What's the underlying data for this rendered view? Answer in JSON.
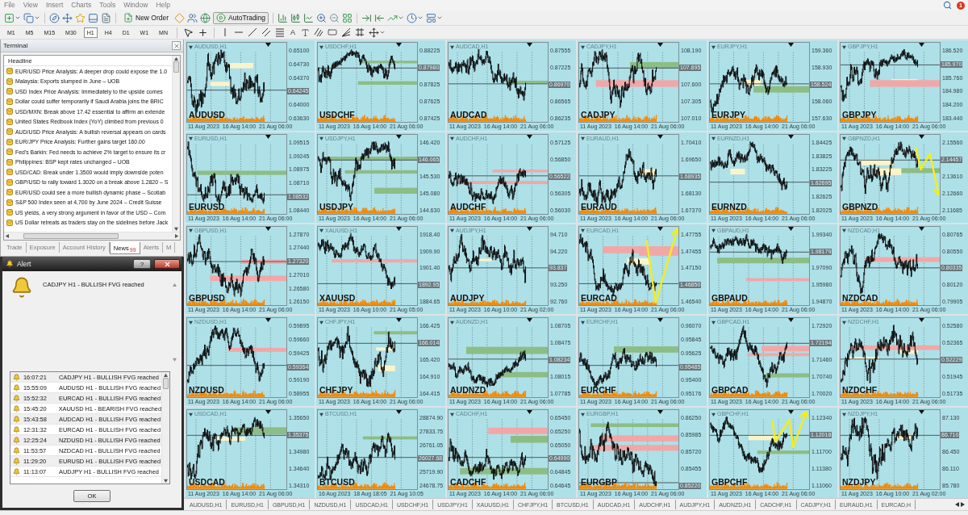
{
  "menu": [
    "File",
    "View",
    "Insert",
    "Charts",
    "Tools",
    "Window",
    "Help"
  ],
  "notification_count": "1",
  "toolbar": {
    "new_order": "New Order",
    "autotrading": "AutoTrading"
  },
  "timeframes": [
    {
      "label": "M1",
      "selected": false
    },
    {
      "label": "M5",
      "selected": false
    },
    {
      "label": "M15",
      "selected": false
    },
    {
      "label": "M30",
      "selected": false
    },
    {
      "label": "H1",
      "selected": true
    },
    {
      "label": "H4",
      "selected": false
    },
    {
      "label": "D1",
      "selected": false
    },
    {
      "label": "W1",
      "selected": false
    },
    {
      "label": "MN",
      "selected": false
    }
  ],
  "text_tool": "A",
  "terminal": {
    "title": "Terminal",
    "column": "Headline",
    "news": [
      "EUR/USD Price Analysis: A deeper drop could expose the 1.0",
      "Malaysia: Exports slumped in June – UOB",
      "USD Index Price Analysis: Immediately to the upside comes",
      "Dollar could suffer temporarily if Saudi Arabia joins the BRIC",
      "USD/MXN: Break above 17.42 essential to affirm an extende",
      "United States Redbook Index (YoY) climbed from previous 0",
      "AUD/USD Price Analysis: A bullish reversal appears on cards",
      "EUR/JPY Price Analysis: Further gains target 160.00",
      "Fed's Barkin: Fed needs to achieve 2% target to ensure its cr",
      "Philippines: BSP kept rates unchanged – UOB",
      "USD/CAD: Break under 1.3500 would imply downside poten",
      "GBP/USD to rally toward 1.3020 on a break above 1.2820 – S",
      "EUR/USD could see a more bullish dynamic phase – Scotiab",
      "S&P 500 Index seen at 4,700 by June 2024 – Credit Suisse",
      "US yields, a very strong argument in favor of the USD – Com",
      "US Dollar retreats as traders stay on the sidelines before Jack"
    ],
    "tabs": [
      {
        "label": "Trade",
        "selected": false
      },
      {
        "label": "Exposure",
        "selected": false
      },
      {
        "label": "Account History",
        "selected": false
      },
      {
        "label": "News",
        "selected": true,
        "badge": "99"
      },
      {
        "label": "Alerts",
        "selected": false
      },
      {
        "label": "M",
        "selected": false
      }
    ]
  },
  "alert": {
    "title": "Alert",
    "help": "?",
    "message": "CADJPY H1 - BULLISH FVG reached",
    "rows": [
      {
        "time": "16:07:21",
        "text": "CADJPY H1 - BULLISH FVG reached"
      },
      {
        "time": "15:55:09",
        "text": "AUDUSD H1 - BULLISH FVG reached"
      },
      {
        "time": "15:52:32",
        "text": "EURCAD H1 - BULLISH FVG reached"
      },
      {
        "time": "15:45:20",
        "text": "XAUUSD H1 - BEARISH FVG reached"
      },
      {
        "time": "15:43:58",
        "text": "AUDCAD H1 - BULLISH FVG reached"
      },
      {
        "time": "12:31:32",
        "text": "EURCAD H1 - BULLISH FVG reached"
      },
      {
        "time": "12:25:24",
        "text": "NZDUSD H1 - BULLISH FVG reached"
      },
      {
        "time": "11:53:57",
        "text": "NZDCAD H1 - BULLISH FVG reached"
      },
      {
        "time": "11:29:20",
        "text": "EURUSD H1 - BULLISH FVG reached"
      },
      {
        "time": "11:13:07",
        "text": "AUDJPY H1 - BULLISH FVG reached"
      }
    ],
    "button": "OK"
  },
  "charts": [
    {
      "title": "AUDUSD,H1",
      "symbol": "AUDUSD",
      "price_axis": [
        {
          "kind": "tick",
          "text": "0.65100"
        },
        {
          "kind": "tick",
          "text": "0.64730"
        },
        {
          "kind": "tick",
          "text": "0.64370"
        },
        {
          "kind": "current",
          "text": "0.64245"
        },
        {
          "kind": "tick",
          "text": "0.64000"
        },
        {
          "kind": "tick",
          "text": "0.63630"
        }
      ],
      "time_axis": [
        "11 Aug 2023",
        "16 Aug 14:00",
        "21 Aug 06:00"
      ]
    },
    {
      "title": "USDCHF,H1",
      "symbol": "USDCHF",
      "price_axis": [
        {
          "kind": "tick",
          "text": "0.88225"
        },
        {
          "kind": "current",
          "text": "0.87980"
        },
        {
          "kind": "tick",
          "text": "0.87825"
        },
        {
          "kind": "tick",
          "text": "0.87625"
        },
        {
          "kind": "tick",
          "text": "0.87425"
        }
      ],
      "time_axis": [
        "11 Aug 2023",
        "16 Aug 14:00",
        "21 Aug 06:00"
      ]
    },
    {
      "title": "AUDCAD,H1",
      "symbol": "AUDCAD",
      "price_axis": [
        {
          "kind": "tick",
          "text": "0.87555"
        },
        {
          "kind": "tick",
          "text": "0.87225"
        },
        {
          "kind": "current",
          "text": "0.86970"
        },
        {
          "kind": "tick",
          "text": "0.86565"
        },
        {
          "kind": "tick",
          "text": "0.86235"
        }
      ],
      "time_axis": [
        "11 Aug 2023",
        "16 Aug 14:00",
        "21 Aug 06:00"
      ]
    },
    {
      "title": "CADJPY,H1",
      "symbol": "CADJPY",
      "price_axis": [
        {
          "kind": "tick",
          "text": "108.190"
        },
        {
          "kind": "current",
          "text": "107.895"
        },
        {
          "kind": "tick",
          "text": "107.600"
        },
        {
          "kind": "tick",
          "text": "107.305"
        },
        {
          "kind": "tick",
          "text": "107.010"
        }
      ],
      "time_axis": [
        "11 Aug 2023",
        "16 Aug 14:00",
        "21 Aug 06:00"
      ]
    },
    {
      "title": "EURJPY,H1",
      "symbol": "EURJPY",
      "price_axis": [
        {
          "kind": "tick",
          "text": "159.360"
        },
        {
          "kind": "tick",
          "text": "158.930"
        },
        {
          "kind": "current",
          "text": "158.524"
        },
        {
          "kind": "tick",
          "text": "158.060"
        },
        {
          "kind": "tick",
          "text": "157.630"
        }
      ],
      "time_axis": [
        "11 Aug 2023",
        "16 Aug 14:00",
        "21 Aug 06:00"
      ]
    },
    {
      "title": "GBPJPY,H1",
      "symbol": "GBPJPY",
      "price_axis": [
        {
          "kind": "tick",
          "text": "186.520"
        },
        {
          "kind": "current",
          "text": "185.970"
        },
        {
          "kind": "tick",
          "text": "185.760"
        },
        {
          "kind": "tick",
          "text": "184.980"
        },
        {
          "kind": "tick",
          "text": "184.200"
        },
        {
          "kind": "tick",
          "text": "183.440"
        }
      ],
      "time_axis": [
        "11 Aug 2023",
        "16 Aug 14:00",
        "21 Aug 06:00"
      ]
    },
    {
      "title": "EURUSD,H1",
      "symbol": "EURUSD",
      "price_axis": [
        {
          "kind": "tick",
          "text": "1.09515"
        },
        {
          "kind": "tick",
          "text": "1.09245"
        },
        {
          "kind": "tick",
          "text": "1.08975"
        },
        {
          "kind": "tick",
          "text": "1.08710"
        },
        {
          "kind": "current",
          "text": "1.08532"
        },
        {
          "kind": "tick",
          "text": "1.08440"
        }
      ],
      "time_axis": [
        "11 Aug 2023",
        "16 Aug 14:00",
        "21 Aug 06:00"
      ]
    },
    {
      "title": "USDJPY,H1",
      "symbol": "USDJPY",
      "price_axis": [
        {
          "kind": "tick",
          "text": "146.420"
        },
        {
          "kind": "current",
          "text": "146.065"
        },
        {
          "kind": "tick",
          "text": "145.530"
        },
        {
          "kind": "tick",
          "text": "145.080"
        },
        {
          "kind": "tick",
          "text": "144.630"
        }
      ],
      "time_axis": [
        "11 Aug 2023",
        "16 Aug 14:00",
        "21 Aug 06:00"
      ]
    },
    {
      "title": "AUDCHF,H1",
      "symbol": "AUDCHF",
      "price_axis": [
        {
          "kind": "tick",
          "text": "0.57125"
        },
        {
          "kind": "tick",
          "text": "0.56850"
        },
        {
          "kind": "current",
          "text": "0.56522"
        },
        {
          "kind": "tick",
          "text": "0.56305"
        },
        {
          "kind": "tick",
          "text": "0.56030"
        }
      ],
      "time_axis": [
        "11 Aug 2023",
        "16 Aug 14:00",
        "21 Aug 06:00"
      ]
    },
    {
      "title": "EURAUD,H1",
      "symbol": "EURAUD",
      "price_axis": [
        {
          "kind": "tick",
          "text": "1.70410"
        },
        {
          "kind": "tick",
          "text": "1.69650"
        },
        {
          "kind": "current",
          "text": "1.68935"
        },
        {
          "kind": "tick",
          "text": "1.68130"
        },
        {
          "kind": "tick",
          "text": "1.67370"
        }
      ],
      "time_axis": [
        "11 Aug 2023",
        "16 Aug 14:00",
        "21 Aug 06:00"
      ]
    },
    {
      "title": "EURNZD,H1",
      "symbol": "EURNZD",
      "price_axis": [
        {
          "kind": "tick",
          "text": "1.84425"
        },
        {
          "kind": "tick",
          "text": "1.83825"
        },
        {
          "kind": "tick",
          "text": "1.83225"
        },
        {
          "kind": "current",
          "text": "1.82695"
        },
        {
          "kind": "tick",
          "text": "1.82625"
        },
        {
          "kind": "tick",
          "text": "1.82025"
        }
      ],
      "time_axis": [
        "11 Aug 2023",
        "16 Aug 14:00",
        "21 Aug 06:00"
      ]
    },
    {
      "title": "GBPNZD,H1",
      "symbol": "GBPNZD",
      "price_axis": [
        {
          "kind": "tick",
          "text": "2.15560"
        },
        {
          "kind": "current",
          "text": "2.14457"
        },
        {
          "kind": "tick",
          "text": "2.13610"
        },
        {
          "kind": "tick",
          "text": "2.12660"
        },
        {
          "kind": "tick",
          "text": "2.11685"
        }
      ],
      "time_axis": [
        "11 Aug 2023",
        "16 Aug 14:00",
        "21 Aug 06:00"
      ],
      "annotation": {
        "kind": "arrow_down"
      }
    },
    {
      "title": "GBPUSD,H1",
      "symbol": "GBPUSD",
      "price_axis": [
        {
          "kind": "tick",
          "text": "1.27870"
        },
        {
          "kind": "tick",
          "text": "1.27440"
        },
        {
          "kind": "current",
          "text": "1.27320"
        },
        {
          "kind": "tick",
          "text": "1.27010"
        },
        {
          "kind": "tick",
          "text": "1.26580"
        },
        {
          "kind": "tick",
          "text": "1.26150"
        }
      ],
      "time_axis": [
        "11 Aug 2023",
        "16 Aug 14:00",
        "21 Aug 06:00"
      ]
    },
    {
      "title": "XAUUSD,H1",
      "symbol": "XAUUSD",
      "price_axis": [
        {
          "kind": "tick",
          "text": "1918.40"
        },
        {
          "kind": "tick",
          "text": "1909.90"
        },
        {
          "kind": "tick",
          "text": "1901.40"
        },
        {
          "kind": "current",
          "text": "1892.95"
        },
        {
          "kind": "tick",
          "text": "1884.65"
        }
      ],
      "time_axis": [
        "11 Aug 2023",
        "16 Aug 10:00",
        "21 Aug 05:00"
      ]
    },
    {
      "title": "AUDJPY,H1",
      "symbol": "AUDJPY",
      "price_axis": [
        {
          "kind": "tick",
          "text": "94.710"
        },
        {
          "kind": "tick",
          "text": "94.220"
        },
        {
          "kind": "current",
          "text": "93.837"
        },
        {
          "kind": "tick",
          "text": "93.250"
        },
        {
          "kind": "tick",
          "text": "92.760"
        }
      ],
      "time_axis": [
        "11 Aug 2023",
        "16 Aug 10:00",
        "21 Aug 02:00"
      ]
    },
    {
      "title": "EURCAD,H1",
      "symbol": "EURCAD",
      "price_axis": [
        {
          "kind": "tick",
          "text": "1.47755"
        },
        {
          "kind": "tick",
          "text": "1.47455"
        },
        {
          "kind": "tick",
          "text": "1.47150"
        },
        {
          "kind": "current",
          "text": "1.46850"
        },
        {
          "kind": "tick",
          "text": "1.46540"
        }
      ],
      "time_axis": [
        "11 Aug 2023",
        "16 Aug 14:00",
        "21 Aug 06:00"
      ],
      "annotation": {
        "kind": "arrow_up_v"
      }
    },
    {
      "title": "GBPAUD,H1",
      "symbol": "GBPAUD",
      "price_axis": [
        {
          "kind": "tick",
          "text": "1.99340"
        },
        {
          "kind": "current",
          "text": "1.98179"
        },
        {
          "kind": "tick",
          "text": "1.97090"
        },
        {
          "kind": "tick",
          "text": "1.95980"
        },
        {
          "kind": "tick",
          "text": "1.94870"
        }
      ],
      "time_axis": [
        "11 Aug 2023",
        "16 Aug 14:00",
        "21 Aug 06:00"
      ]
    },
    {
      "title": "NZDCAD,H1",
      "symbol": "NZDCAD",
      "price_axis": [
        {
          "kind": "tick",
          "text": "0.80765"
        },
        {
          "kind": "tick",
          "text": "0.80550"
        },
        {
          "kind": "current",
          "text": "0.80335"
        },
        {
          "kind": "tick",
          "text": "0.80120"
        },
        {
          "kind": "tick",
          "text": "0.79905"
        }
      ],
      "time_axis": [
        "11 Aug 2023",
        "16 Aug 14:00",
        "21 Aug 06:00"
      ]
    },
    {
      "title": "NZDUSD,H1",
      "symbol": "NZDUSD",
      "price_axis": [
        {
          "kind": "tick",
          "text": "0.59895"
        },
        {
          "kind": "tick",
          "text": "0.59660"
        },
        {
          "kind": "tick",
          "text": "0.59425"
        },
        {
          "kind": "current",
          "text": "0.59364"
        },
        {
          "kind": "tick",
          "text": "0.59190"
        },
        {
          "kind": "tick",
          "text": "0.58955"
        }
      ],
      "time_axis": [
        "11 Aug 2023",
        "16 Aug 14:00",
        "21 Aug 06:00"
      ]
    },
    {
      "title": "CHFJPY,H1",
      "symbol": "CHFJPY",
      "price_axis": [
        {
          "kind": "tick",
          "text": "166.425"
        },
        {
          "kind": "current",
          "text": "166.014"
        },
        {
          "kind": "tick",
          "text": "165.420"
        },
        {
          "kind": "tick",
          "text": "164.910"
        },
        {
          "kind": "tick",
          "text": "164.415"
        }
      ],
      "time_axis": [
        "11 Aug 2023",
        "16 Aug 14:00",
        "21 Aug 06:00"
      ]
    },
    {
      "title": "AUDNZD,H1",
      "symbol": "AUDNZD",
      "price_axis": [
        {
          "kind": "tick",
          "text": "1.08705"
        },
        {
          "kind": "tick",
          "text": "1.08475"
        },
        {
          "kind": "current",
          "text": "1.08234"
        },
        {
          "kind": "tick",
          "text": "1.08015"
        },
        {
          "kind": "tick",
          "text": "1.07785"
        }
      ],
      "time_axis": [
        "11 Aug 2023",
        "16 Aug 14:00",
        "21 Aug 06:00"
      ]
    },
    {
      "title": "EURCHF,H1",
      "symbol": "EURCHF",
      "price_axis": [
        {
          "kind": "tick",
          "text": "0.96070"
        },
        {
          "kind": "tick",
          "text": "0.95845"
        },
        {
          "kind": "tick",
          "text": "0.95625"
        },
        {
          "kind": "current",
          "text": "0.95485"
        },
        {
          "kind": "tick",
          "text": "0.95400"
        },
        {
          "kind": "tick",
          "text": "0.95176"
        }
      ],
      "time_axis": [
        "11 Aug 2023",
        "16 Aug 14:00",
        "21 Aug 06:00"
      ]
    },
    {
      "title": "GBPCAD,H1",
      "symbol": "GBPCAD",
      "price_axis": [
        {
          "kind": "tick",
          "text": "1.72920"
        },
        {
          "kind": "current",
          "text": "1.72194"
        },
        {
          "kind": "tick",
          "text": "1.71460"
        },
        {
          "kind": "tick",
          "text": "1.70740"
        },
        {
          "kind": "tick",
          "text": "1.70020"
        }
      ],
      "time_axis": [
        "11 Aug 2023",
        "16 Aug 14:00",
        "21 Aug 06:00"
      ]
    },
    {
      "title": "NZDCHF,H1",
      "symbol": "NZDCHF",
      "price_axis": [
        {
          "kind": "tick",
          "text": "0.52580"
        },
        {
          "kind": "tick",
          "text": "0.52365"
        },
        {
          "kind": "current",
          "text": "0.52229"
        },
        {
          "kind": "tick",
          "text": "0.51945"
        },
        {
          "kind": "tick",
          "text": "0.51735"
        }
      ],
      "time_axis": [
        "11 Aug 2023",
        "16 Aug 14:00",
        "21 Aug 06:00"
      ]
    },
    {
      "title": "USDCAD,H1",
      "symbol": "USDCAD",
      "price_axis": [
        {
          "kind": "tick",
          "text": "1.35650"
        },
        {
          "kind": "current",
          "text": "1.35375"
        },
        {
          "kind": "tick",
          "text": "1.34980"
        },
        {
          "kind": "tick",
          "text": "1.34640"
        },
        {
          "kind": "tick",
          "text": "1.34310"
        }
      ],
      "time_axis": [
        "11 Aug 2023",
        "16 Aug 14:00",
        "21 Aug 06:00"
      ]
    },
    {
      "title": "BTCUSD,H1",
      "symbol": "BTCUSD",
      "price_axis": [
        {
          "kind": "tick",
          "text": "28874.90"
        },
        {
          "kind": "tick",
          "text": "27833.75"
        },
        {
          "kind": "tick",
          "text": "26761.05"
        },
        {
          "kind": "current",
          "text": "26027.68"
        },
        {
          "kind": "tick",
          "text": "25719.90"
        },
        {
          "kind": "tick",
          "text": "24678.75"
        }
      ],
      "time_axis": [
        "16 Aug 2023",
        "18 Aug 18:05",
        "21 Aug 10:05"
      ]
    },
    {
      "title": "CADCHF,H1",
      "symbol": "CADCHF",
      "price_axis": [
        {
          "kind": "tick",
          "text": "0.65450"
        },
        {
          "kind": "tick",
          "text": "0.65250"
        },
        {
          "kind": "tick",
          "text": "0.65050"
        },
        {
          "kind": "current",
          "text": "0.64990"
        },
        {
          "kind": "tick",
          "text": "0.64845"
        },
        {
          "kind": "tick",
          "text": "0.64645"
        }
      ],
      "time_axis": [
        "11 Aug 2023",
        "16 Aug 14:00",
        "21 Aug 06:00"
      ]
    },
    {
      "title": "EURGBP,H1",
      "symbol": "EURGBP",
      "price_axis": [
        {
          "kind": "tick",
          "text": "0.86250"
        },
        {
          "kind": "tick",
          "text": "0.85985"
        },
        {
          "kind": "tick",
          "text": "0.85720"
        },
        {
          "kind": "tick",
          "text": "0.85455"
        },
        {
          "kind": "current",
          "text": "0.85220"
        }
      ],
      "time_axis": [
        "11 Aug 2023",
        "16 Aug 14:00",
        "21 Aug 06:00"
      ]
    },
    {
      "title": "GBPCHF,H1",
      "symbol": "GBPCHF",
      "price_axis": [
        {
          "kind": "tick",
          "text": "1.12340"
        },
        {
          "kind": "current",
          "text": "1.12018"
        },
        {
          "kind": "tick",
          "text": "1.11700"
        },
        {
          "kind": "tick",
          "text": "1.11380"
        },
        {
          "kind": "tick",
          "text": "1.11060"
        }
      ],
      "time_axis": [
        "11 Aug 2023",
        "16 Aug 14:00",
        "21 Aug 06:00"
      ],
      "annotation": {
        "kind": "arrow_up"
      }
    },
    {
      "title": "NZDJPY,H1",
      "symbol": "NZDJPY",
      "price_axis": [
        {
          "kind": "tick",
          "text": "87.130"
        },
        {
          "kind": "current",
          "text": "86.710"
        },
        {
          "kind": "tick",
          "text": "86.450"
        },
        {
          "kind": "tick",
          "text": "86.110"
        },
        {
          "kind": "tick",
          "text": "85.780"
        }
      ],
      "time_axis": [
        "11 Aug 2023",
        "16 Aug 10:00",
        "21 Aug 02:00"
      ]
    }
  ],
  "chart_tabs": [
    "AUDUSD,H1",
    "EURUSD,H1",
    "GBPUSD,H1",
    "NZDUSD,H1",
    "USDCAD,H1",
    "USDCHF,H1",
    "USDJPY,H1",
    "XAUUSD,H1",
    "CHFJPY,H1",
    "BTCUSD,H1",
    "AUDCAD,H1",
    "AUDCHF,H1",
    "AUDJPY,H1",
    "AUDNZD,H1",
    "CADCHF,H1",
    "CADJPY,H1",
    "EURAUD,H1",
    "EURCAD,H"
  ]
}
